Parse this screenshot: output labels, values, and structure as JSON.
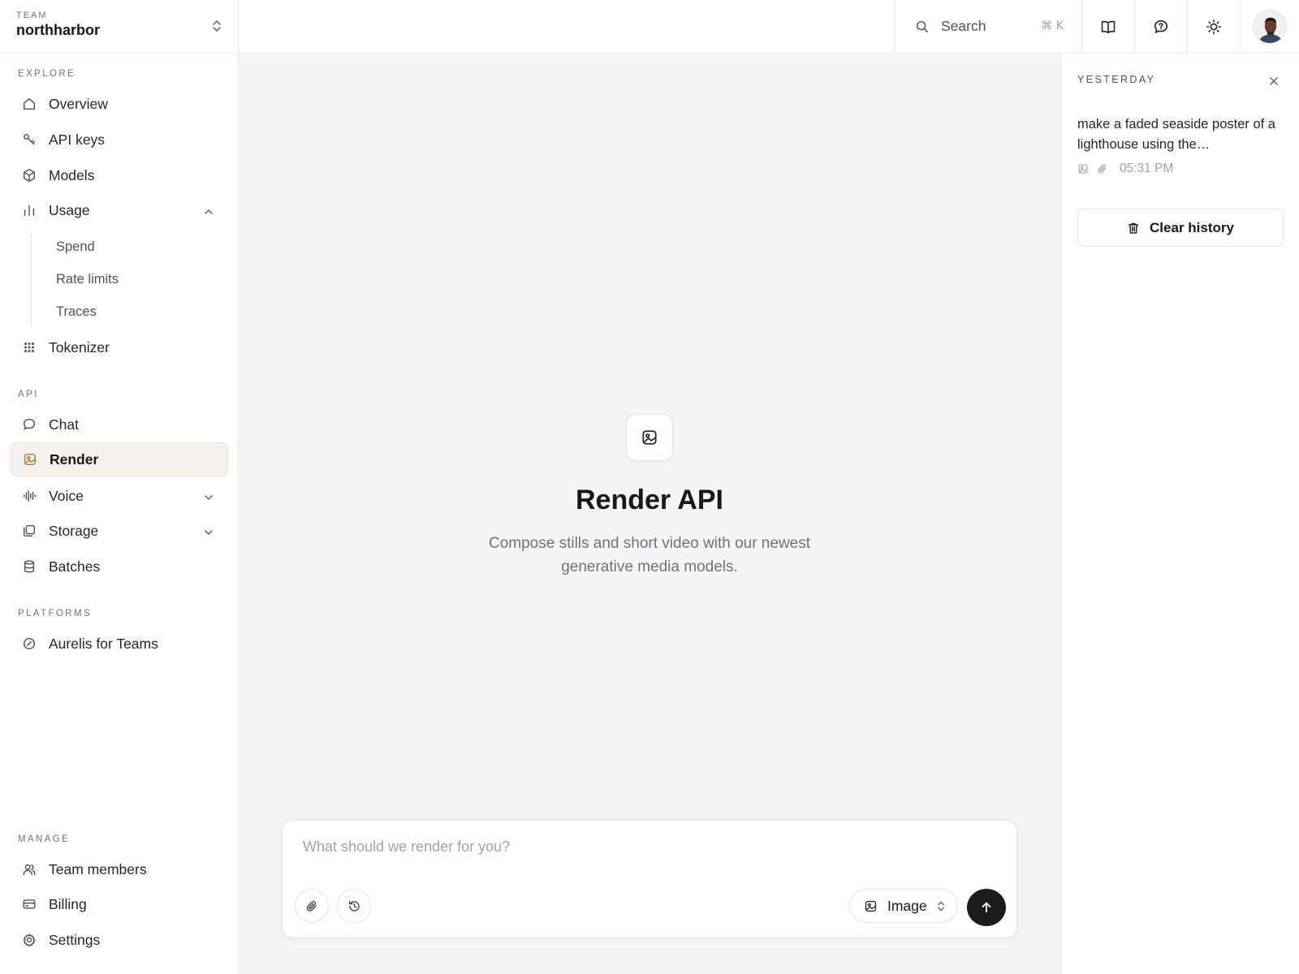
{
  "team": {
    "label": "TEAM",
    "name": "northharbor"
  },
  "sidebar": {
    "sections": {
      "explore": "EXPLORE",
      "api": "API",
      "platforms": "PLATFORMS",
      "manage": "MANAGE"
    },
    "items": {
      "overview": "Overview",
      "api_keys": "API keys",
      "models": "Models",
      "usage": "Usage",
      "spend": "Spend",
      "rate_limits": "Rate limits",
      "traces": "Traces",
      "tokenizer": "Tokenizer",
      "chat": "Chat",
      "render": "Render",
      "voice": "Voice",
      "storage": "Storage",
      "batches": "Batches",
      "aurelis_teams": "Aurelis for Teams",
      "team_members": "Team members",
      "billing": "Billing",
      "settings": "Settings"
    },
    "active_item": "render",
    "accent_color": "#b07a3c"
  },
  "topbar": {
    "search_placeholder": "Search",
    "search_shortcut": "⌘ K",
    "icons": [
      "book-icon",
      "help-chat-icon",
      "sun-icon",
      "avatar"
    ]
  },
  "main": {
    "title": "Render API",
    "subtitle": "Compose stills and short video with our newest generative media models.",
    "composer": {
      "placeholder": "What should we render for you?",
      "value": "",
      "mode": "Image"
    }
  },
  "history": {
    "group_label": "YESTERDAY",
    "items": [
      {
        "text": "make a faded seaside poster of a lighthouse using the…",
        "time": "05:31 PM"
      }
    ],
    "clear_label": "Clear history"
  }
}
